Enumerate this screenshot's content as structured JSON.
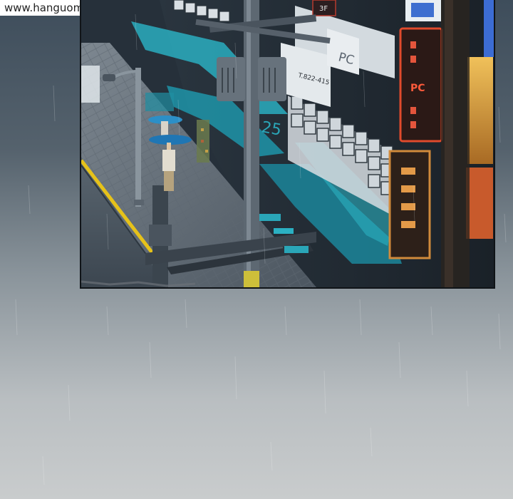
{
  "watermark": {
    "text": "www.hanguomanhua.me"
  },
  "scene": {
    "signs": {
      "floor_3f": "3F",
      "pc": "PC",
      "phone": "T.822-415",
      "number_25": "25",
      "neon_pc": "PC"
    }
  },
  "colors": {
    "teal": "#2aa6b8",
    "neon_red": "#d8402e",
    "sign_amber": "#d99a3a",
    "curb_yellow": "#e6c21a",
    "sky_top": "#3e4d5b",
    "sky_bottom": "#c9cccd"
  }
}
